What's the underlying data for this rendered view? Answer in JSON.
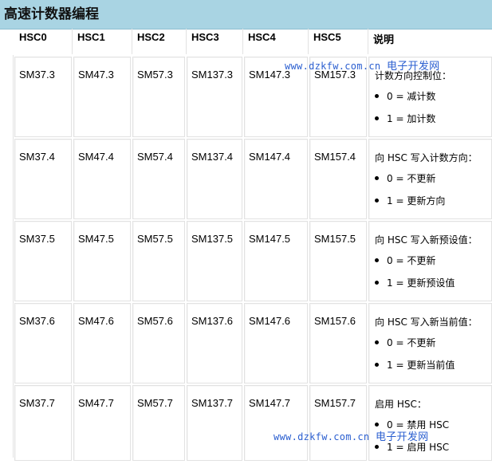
{
  "page": {
    "title": "高速计数器编程"
  },
  "table": {
    "headers": [
      "HSC0",
      "HSC1",
      "HSC2",
      "HSC3",
      "HSC4",
      "HSC5",
      "说明"
    ],
    "rows": [
      {
        "cells": [
          "SM37.3",
          "SM47.3",
          "SM57.3",
          "SM137.3",
          "SM147.3",
          "SM157.3"
        ],
        "desc_title": "计数方向控制位：",
        "options": [
          "0 = 减计数",
          "1 = 加计数"
        ]
      },
      {
        "cells": [
          "SM37.4",
          "SM47.4",
          "SM57.4",
          "SM137.4",
          "SM147.4",
          "SM157.4"
        ],
        "desc_title": "向 HSC 写入计数方向：",
        "options": [
          "0 = 不更新",
          "1 = 更新方向"
        ]
      },
      {
        "cells": [
          "SM37.5",
          "SM47.5",
          "SM57.5",
          "SM137.5",
          "SM147.5",
          "SM157.5"
        ],
        "desc_title": "向 HSC 写入新预设值：",
        "options": [
          "0 = 不更新",
          "1 = 更新预设值"
        ]
      },
      {
        "cells": [
          "SM37.6",
          "SM47.6",
          "SM57.6",
          "SM137.6",
          "SM147.6",
          "SM157.6"
        ],
        "desc_title": "向 HSC 写入新当前值：",
        "options": [
          "0 = 不更新",
          "1 = 更新当前值"
        ]
      },
      {
        "cells": [
          "SM37.7",
          "SM47.7",
          "SM57.7",
          "SM137.7",
          "SM147.7",
          "SM157.7"
        ],
        "desc_title": "启用 HSC：",
        "options": [
          "0 = 禁用 HSC",
          "1 = 启用 HSC"
        ]
      }
    ]
  },
  "watermark": {
    "url": "www.dzkfw.com.cn",
    "site": "电子开发网"
  },
  "colors": {
    "title_bar": "#a9d4e3",
    "watermark": "#2b5fd0",
    "border": "#e2e2e2"
  }
}
